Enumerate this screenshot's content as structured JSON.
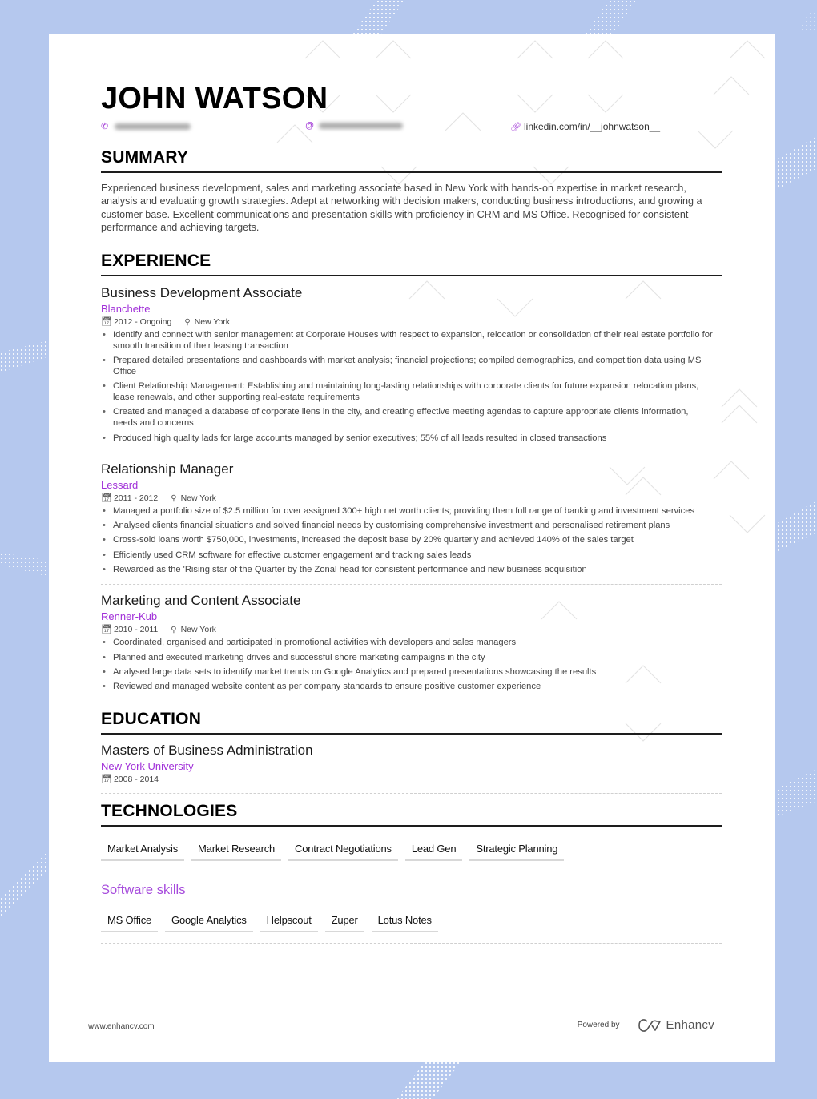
{
  "resume": {
    "name": "JOHN WATSON",
    "contacts": {
      "phone_icon": "phone-icon",
      "phone": "(redacted)",
      "email_icon": "at-icon",
      "email": "(redacted)",
      "link_icon": "link-icon",
      "linkedin": "linkedin.com/in/__johnwatson__"
    },
    "summary": {
      "title": "SUMMARY",
      "text": "Experienced business development, sales and marketing associate based in New York with hands-on expertise in market research, analysis and evaluating growth strategies. Adept at networking with decision makers, conducting business introductions, and growing a customer base. Excellent communications and presentation skills with proficiency in CRM and MS Office. Recognised for consistent performance and achieving targets."
    },
    "experience": {
      "title": "EXPERIENCE",
      "items": [
        {
          "role": "Business Development Associate",
          "company": "Blanchette",
          "dates": "2012 - Ongoing",
          "location": "New York",
          "bullets": [
            "Identify and connect with senior management at Corporate Houses with respect to expansion, relocation or consolidation of their real estate portfolio for smooth transition of their leasing transaction",
            "Prepared detailed presentations and dashboards with market analysis; financial projections; compiled demographics, and competition data using MS Office",
            "Client Relationship Management: Establishing and maintaining long-lasting relationships with corporate clients for future expansion relocation plans, lease renewals, and other supporting real-estate requirements",
            "Created and managed a database of corporate liens in the city, and creating effective meeting agendas to capture appropriate clients information, needs and concerns",
            "Produced high quality lads for large accounts managed by senior executives; 55% of all leads resulted in closed transactions"
          ]
        },
        {
          "role": "Relationship Manager",
          "company": "Lessard",
          "dates": "2011 - 2012",
          "location": "New York",
          "bullets": [
            "Managed a portfolio size of $2.5 million for over assigned 300+ high net worth clients; providing them full range of banking and investment services",
            "Analysed clients financial situations and solved financial needs by customising comprehensive investment and personalised retirement plans",
            "Cross-sold loans worth $750,000, investments, increased the deposit base by 20% quarterly and achieved 140% of the sales target",
            "Efficiently used CRM software for effective customer engagement and tracking sales leads",
            "Rewarded as the 'Rising star of the Quarter by the Zonal head for consistent performance and new business acquisition"
          ]
        },
        {
          "role": "Marketing and Content Associate",
          "company": "Renner-Kub",
          "dates": "2010 - 2011",
          "location": "New York",
          "bullets": [
            "Coordinated, organised and participated in promotional activities with developers and sales managers",
            "Planned and executed marketing drives and successful shore marketing campaigns in the city",
            "Analysed large data sets to identify market trends on Google Analytics and prepared presentations showcasing the results",
            "Reviewed and managed website content as per company standards to ensure positive customer experience"
          ]
        }
      ]
    },
    "education": {
      "title": "EDUCATION",
      "degree": "Masters of Business Administration",
      "school": "New York University",
      "dates": "2008 - 2014"
    },
    "technologies": {
      "title": "TECHNOLOGIES",
      "tags": [
        "Market Analysis",
        "Market Research",
        "Contract Negotiations",
        "Lead Gen",
        "Strategic Planning"
      ],
      "software_heading": "Software skills",
      "software_tags": [
        "MS Office",
        "Google Analytics",
        "Helpscout",
        "Zuper",
        "Lotus Notes"
      ]
    },
    "footer": {
      "website": "www.enhancv.com",
      "powered_by": "Powered by",
      "brand": "Enhancv"
    },
    "colors": {
      "accent": "#a02fd8",
      "background": "#b5c8ee"
    }
  }
}
